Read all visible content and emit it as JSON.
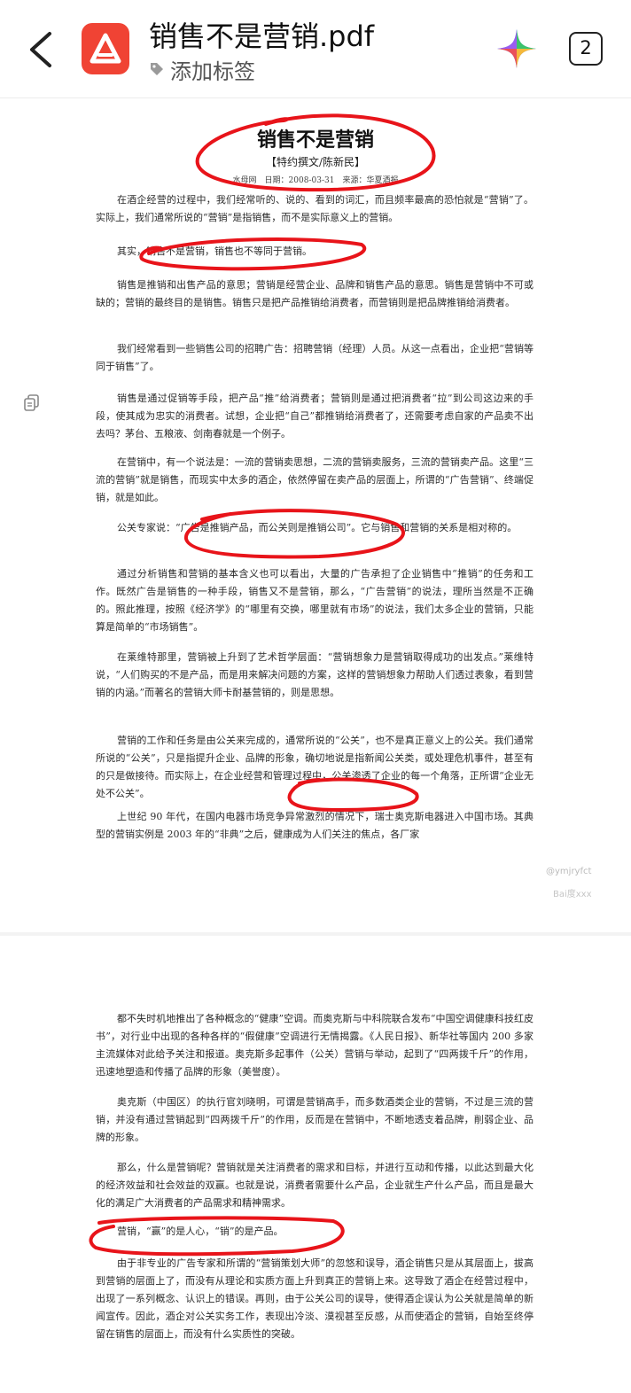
{
  "header": {
    "file_title": "销售不是营销.pdf",
    "tag_label": "添加标签",
    "page_count": "2",
    "app_icon": "pdf-app-icon",
    "accent_color": "#f04334"
  },
  "page1": {
    "title": "销售不是营销",
    "author": "【特约撰文/陈新民】",
    "meta": "水母网　日期：2008-03-31　来源：华夏酒报",
    "paragraphs": [
      "在酒企经营的过程中，我们经常听的、说的、看到的词汇，而且频率最高的恐怕就是“营销”了。实际上，我们通常所说的“营销”是指销售，而不是实际意义上的营销。",
      "其实，销售不是营销，销售也不等同于营销。",
      "销售是推销和出售产品的意思；营销是经营企业、品牌和销售产品的意思。销售是营销中不可或缺的；营销的最终目的是销售。销售只是把产品推销给消费者，而营销则是把品牌推销给消费者。",
      "我们经常看到一些销售公司的招聘广告：招聘营销（经理）人员。从这一点看出，企业把“营销等同于销售”了。",
      "销售是通过促销等手段，把产品“推”给消费者；营销则是通过把消费者“拉”到公司这边来的手段，使其成为忠实的消费者。试想，企业把“自己”都推销给消费者了，还需要考虑自家的产品卖不出去吗？茅台、五粮液、剑南春就是一个例子。",
      "在营销中，有一个说法是：一流的营销卖思想，二流的营销卖服务，三流的营销卖产品。这里“三流的营销”就是销售，而现实中太多的酒企，依然停留在卖产品的层面上，所谓的“广告营销”、终端促销，就是如此。",
      "公关专家说：“广告是推销产品，而公关则是推销公司”。它与销售和营销的关系是相对称的。",
      "通过分析销售和营销的基本含义也可以看出，大量的广告承担了企业销售中“推销”的任务和工作。既然广告是销售的一种手段，销售又不是营销，那么，“广告营销”的说法，理所当然是不正确的。照此推理，按照《经济学》的“哪里有交换，哪里就有市场”的说法，我们太多企业的营销，只能算是简单的“市场销售”。",
      "在莱维特那里，营销被上升到了艺术哲学层面：“营销想象力是营销取得成功的出发点。”莱维特说，“人们购买的不是产品，而是用来解决问题的方案，这样的营销想象力帮助人们透过表象，看到营销的内涵。”而著名的营销大师卡耐基营销的，则是思想。",
      "营销的工作和任务是由公关来完成的，通常所说的“公关”，也不是真正意义上的公关。我们通常所说的“公关”，只是指提升企业、品牌的形象，确切地说是指新闻公关类，或处理危机事件，甚至有的只是做接待。而实际上，在企业经营和管理过程中，公关渗透了企业的每一个角落，正所谓“企业无处不公关”。",
      "上世纪 90 年代，在国内电器市场竞争异常激烈的情况下，瑞士奥克斯电器进入中国市场。其典型的营销实例是 2003 年的“非典”之后，健康成为人们关注的焦点，各厂家"
    ],
    "watermark_1": "@ymjryfct",
    "watermark_2": "Bai度xxx"
  },
  "page2": {
    "paragraphs": [
      "都不失时机地推出了各种概念的“健康”空调。而奥克斯与中科院联合发布“中国空调健康科技红皮书”，对行业中出现的各种各样的“假健康”空调进行无情揭露。《人民日报》、新华社等国内 200 多家主流媒体对此给予关注和报道。奥克斯多起事件（公关）营销与举动，起到了“四两拨千斤”的作用，迅速地塑造和传播了品牌的形象（美誉度）。",
      "奥克斯（中国区）的执行官刘晓明，可谓是营销高手，而多数酒类企业的营销，不过是三流的营销，并没有通过营销起到“四两拨千斤”的作用，反而是在营销中，不断地透支着品牌，削弱企业、品牌的形象。",
      "那么，什么是营销呢？营销就是关注消费者的需求和目标，并进行互动和传播，以此达到最大化的经济效益和社会效益的双赢。也就是说，消费者需要什么产品，企业就生产什么产品，而且是最大化的满足广大消费者的产品需求和精神需求。",
      "营销，“赢”的是人心，“销”的是产品。",
      "由于非专业的广告专家和所谓的“营销策划大师”的忽悠和误导，酒企销售只是从其层面上，拔高到营销的层面上了，而没有从理论和实质方面上升到真正的营销上来。这导致了酒企在经营过程中，出现了一系列概念、认识上的错误。再则，由于公关公司的误导，使得酒企误认为公关就是简单的新闻宣传。因此，酒企对公关实务工作，表现出冷淡、漠视甚至反感，从而使酒企的营销，自始至终停留在销售的层面上，而没有什么实质性的突破。"
    ]
  }
}
